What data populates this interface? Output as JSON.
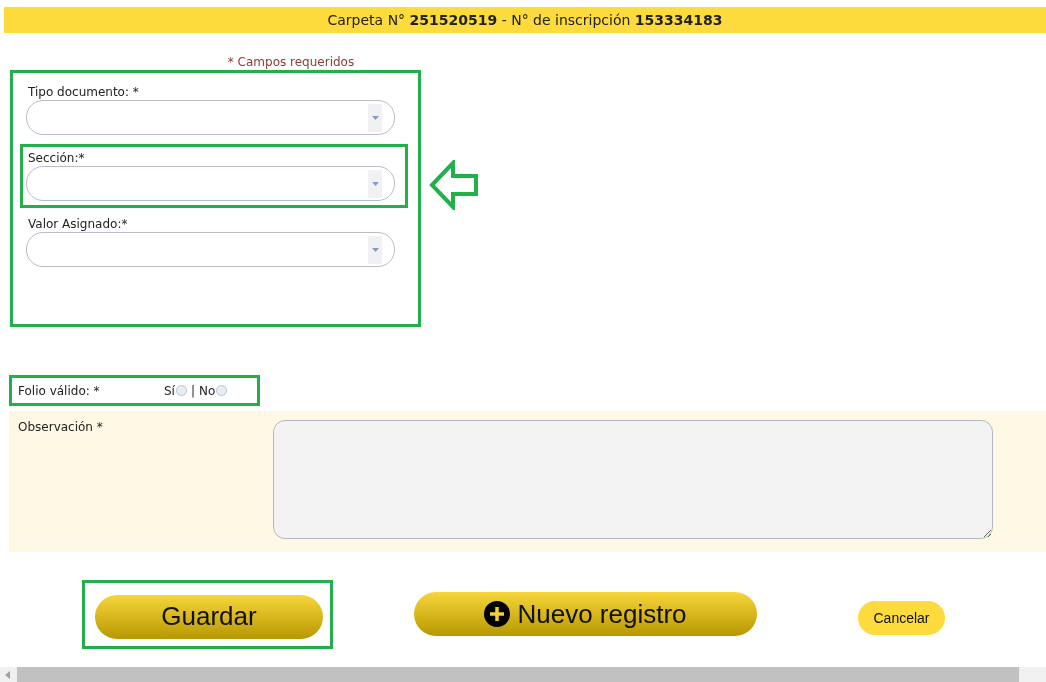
{
  "header": {
    "text": "Carpeta N° **251520519** - N° de inscripción **153334183**"
  },
  "required_note": "* Campos requeridos",
  "fields_group": {
    "highlighted": true,
    "fields": [
      {
        "label": "Tipo documento: *",
        "highlighted": false
      },
      {
        "label": "Sección:*",
        "highlighted": true
      },
      {
        "label": "Valor Asignado:*",
        "highlighted": false
      }
    ]
  },
  "folio": {
    "label": "Folio válido: *",
    "highlighted": true,
    "separator": "|",
    "options": [
      {
        "label": "Sí",
        "selected": false
      },
      {
        "label": "No",
        "selected": false
      }
    ]
  },
  "observation": {
    "label": "Observación *"
  },
  "buttons": [
    {
      "kind": "primary",
      "label": "Guardar",
      "highlighted": true
    },
    {
      "kind": "add",
      "label": "Nuevo registro",
      "highlighted": false
    },
    {
      "kind": "small",
      "label": "Cancelar",
      "highlighted": false
    }
  ]
}
